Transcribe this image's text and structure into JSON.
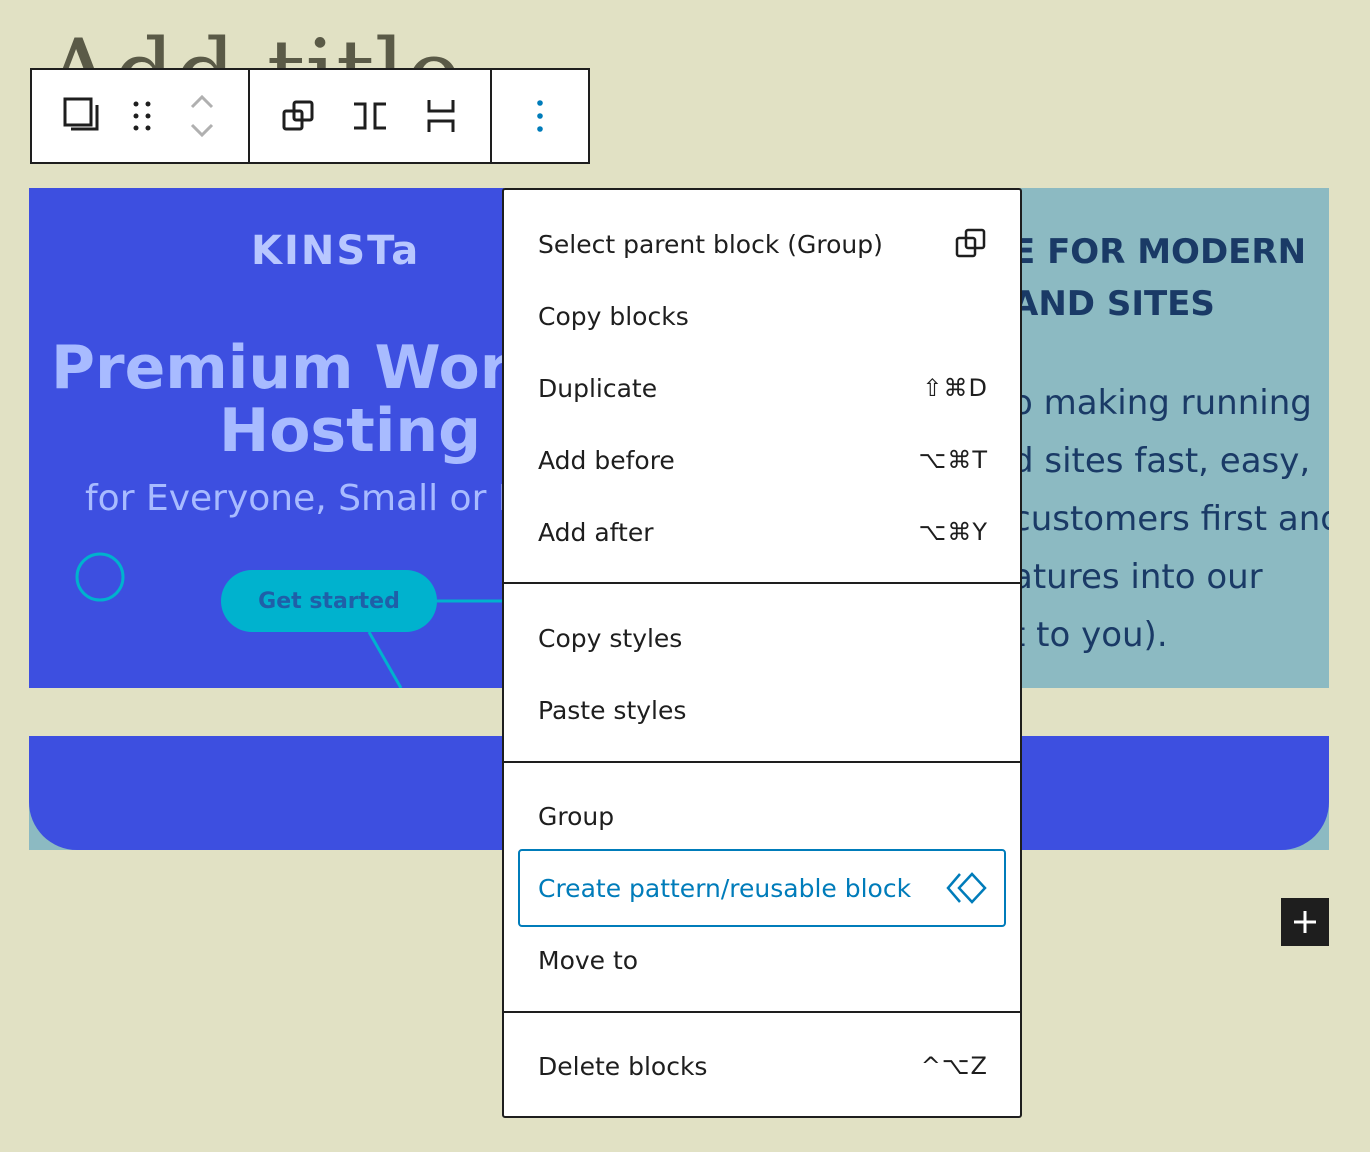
{
  "post": {
    "title_placeholder": "Add title"
  },
  "toolbar": {
    "buttons": [
      "parent-block",
      "drag-handle",
      "move-up",
      "move-down",
      "group-icon",
      "row-icon",
      "stack-icon",
      "options"
    ]
  },
  "kinsta": {
    "brand": "KINSTa",
    "headline_1": "Premium WordPress",
    "headline_2": "Hosting",
    "subline": "for Everyone, Small or Large",
    "cta": "Get started"
  },
  "right_panel": {
    "heading_1": "E FOR MODERN",
    "heading_2": "AND SITES",
    "body": [
      "o making running",
      "d sites fast, easy,",
      "customers first and",
      "atures into our",
      "t to you)."
    ]
  },
  "menu": {
    "groups": [
      [
        {
          "label": "Select parent block (Group)",
          "icon": "parent-block-icon"
        },
        {
          "label": "Copy blocks"
        },
        {
          "label": "Duplicate",
          "shortcut": "⇧⌘D"
        },
        {
          "label": "Add before",
          "shortcut": "⌥⌘T"
        },
        {
          "label": "Add after",
          "shortcut": "⌥⌘Y"
        }
      ],
      [
        {
          "label": "Copy styles"
        },
        {
          "label": "Paste styles"
        }
      ],
      [
        {
          "label": "Group"
        },
        {
          "label": "Create pattern/reusable block",
          "icon": "pattern-icon",
          "active": true
        },
        {
          "label": "Move to"
        }
      ],
      [
        {
          "label": "Delete blocks",
          "shortcut": "^⌥Z"
        }
      ]
    ]
  },
  "colors": {
    "background": "#e1e1c4",
    "kinsta_blue": "#3d4fe0",
    "accent": "#007cba",
    "panel_teal": "#8cbac2"
  }
}
